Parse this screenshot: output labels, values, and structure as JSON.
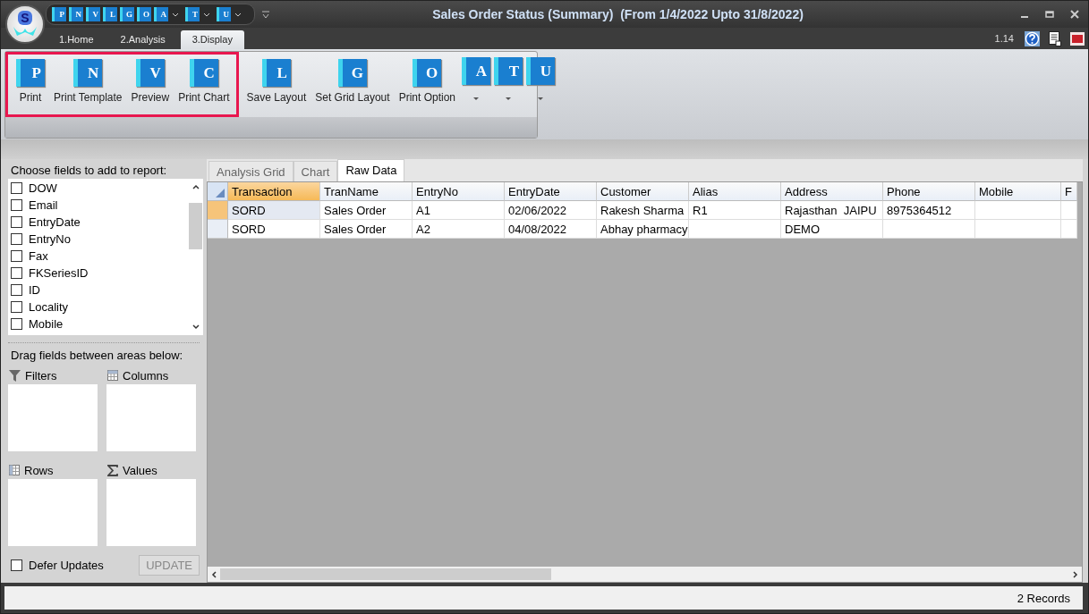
{
  "window": {
    "title": "Sales Order Status (Summary)  (From 1/4/2022 Upto 31/8/2022)",
    "version": "1.14"
  },
  "logo": {
    "letter": "S"
  },
  "quick_access": [
    {
      "letter": "P",
      "dropdown": false
    },
    {
      "letter": "N",
      "dropdown": false
    },
    {
      "letter": "V",
      "dropdown": false
    },
    {
      "letter": "L",
      "dropdown": false
    },
    {
      "letter": "G",
      "dropdown": false
    },
    {
      "letter": "O",
      "dropdown": false
    },
    {
      "letter": "A",
      "dropdown": true
    },
    {
      "letter": "T",
      "dropdown": true
    },
    {
      "letter": "U",
      "dropdown": true
    }
  ],
  "ribbon_tabs": [
    {
      "label": "1.Home",
      "selected": false
    },
    {
      "label": "2.Analysis",
      "selected": false
    },
    {
      "label": "3.Display",
      "selected": true
    }
  ],
  "ribbon": {
    "groups": [
      {
        "highlighted": true,
        "buttons": [
          {
            "kind": "large",
            "label": "Print",
            "letter": "P"
          },
          {
            "kind": "large",
            "label": "Print Template",
            "letter": "N"
          },
          {
            "kind": "large",
            "label": "Preview",
            "letter": "V"
          },
          {
            "kind": "large",
            "label": "Print Chart",
            "letter": "C"
          }
        ]
      },
      {
        "highlighted": false,
        "buttons": [
          {
            "kind": "large",
            "label": "Save Layout",
            "letter": "L"
          },
          {
            "kind": "large",
            "label": "Set Grid Layout",
            "letter": "G"
          },
          {
            "kind": "large",
            "label": "Print Option",
            "letter": "O"
          },
          {
            "kind": "dropdown",
            "letter": "A"
          },
          {
            "kind": "dropdown",
            "letter": "T"
          },
          {
            "kind": "dropdown",
            "letter": "U"
          }
        ]
      }
    ]
  },
  "field_chooser": {
    "title": "Choose fields to add to report:",
    "fields": [
      {
        "label": "DOW",
        "checked": false
      },
      {
        "label": "Email",
        "checked": false
      },
      {
        "label": "EntryDate",
        "checked": false
      },
      {
        "label": "EntryNo",
        "checked": false
      },
      {
        "label": "Fax",
        "checked": false
      },
      {
        "label": "FKSeriesID",
        "checked": false
      },
      {
        "label": "ID",
        "checked": false
      },
      {
        "label": "Locality",
        "checked": false
      },
      {
        "label": "Mobile",
        "checked": false
      }
    ],
    "areas_title": "Drag fields between areas below:",
    "areas": [
      {
        "kind": "filters",
        "label": "Filters"
      },
      {
        "kind": "columns",
        "label": "Columns"
      },
      {
        "kind": "rows",
        "label": "Rows"
      },
      {
        "kind": "values",
        "label": "Values"
      }
    ],
    "defer_updates": {
      "label": "Defer Updates",
      "checked": false
    },
    "update_button": {
      "label": "UPDATE",
      "disabled": true
    }
  },
  "grid": {
    "tabs": [
      {
        "label": "Analysis Grid",
        "selected": false
      },
      {
        "label": "Chart",
        "selected": false
      },
      {
        "label": "Raw Data",
        "selected": true
      }
    ],
    "columns": [
      "Transaction",
      "TranName",
      "EntryNo",
      "EntryDate",
      "Customer",
      "Alias",
      "Address",
      "Phone",
      "Mobile",
      "F"
    ],
    "rows": [
      {
        "selected": true,
        "cells": [
          "SORD",
          "Sales Order",
          "A1",
          "02/06/2022",
          "Rakesh Sharma",
          "R1",
          "Rajasthan  JAIPU",
          "8975364512",
          null,
          null
        ]
      },
      {
        "selected": false,
        "cells": [
          "SORD",
          "Sales Order",
          "A2",
          "04/08/2022",
          "Abhay pharmacy",
          null,
          "DEMO",
          null,
          null,
          null
        ]
      }
    ]
  },
  "status_bar": {
    "records": "2 Records"
  }
}
